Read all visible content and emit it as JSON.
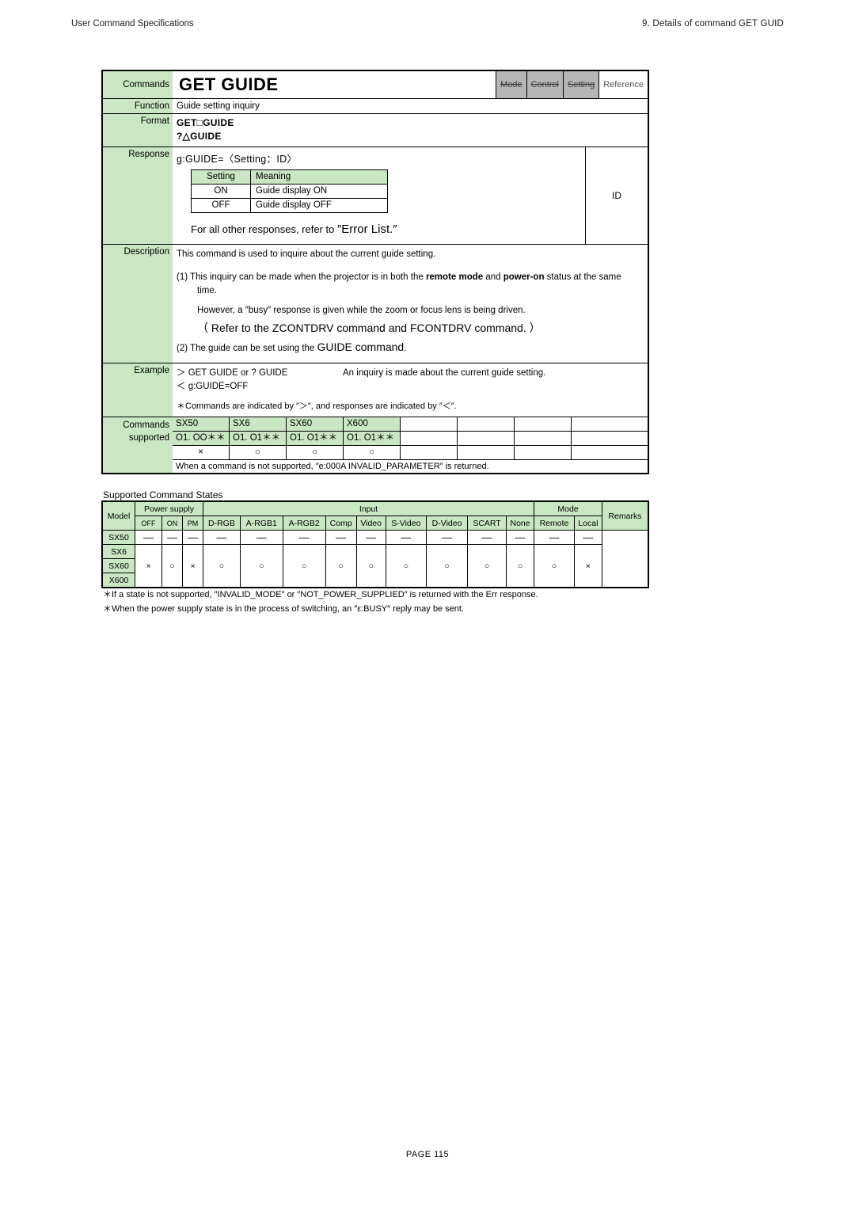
{
  "header": {
    "left": "User Command Specifications",
    "right": "9. Details of command  GET GUID"
  },
  "command_sheet": {
    "labels": {
      "commands": "Commands",
      "function": "Function",
      "format": "Format",
      "response": "Response",
      "description": "Description",
      "example": "Example",
      "commands_supported_1": "Commands",
      "commands_supported_2": "supported"
    },
    "title": "GET GUIDE",
    "tags": [
      {
        "text": "Mode",
        "state": "struck"
      },
      {
        "text": "Control",
        "state": "struck"
      },
      {
        "text": "Setting",
        "state": "struck"
      },
      {
        "text": "Reference",
        "state": "plain"
      }
    ],
    "function_text": "Guide setting inquiry",
    "format_lines": [
      "GET□GUIDE",
      "?△GUIDE"
    ],
    "response": {
      "syntax": "g:GUIDE=〈Setting：ID〉",
      "table": {
        "headers": [
          "Setting",
          "Meaning"
        ],
        "rows": [
          [
            "ON",
            "Guide display ON"
          ],
          [
            "OFF",
            "Guide display OFF"
          ]
        ]
      },
      "id_cell": "ID",
      "error_prefix": "For all other responses, refer to ",
      "error_ref": "″Error List.″"
    },
    "description": {
      "line1": "This command is used to inquire about the current guide setting.",
      "item1_pre": "(1) This inquiry can be made when the projector is in both the ",
      "item1_b1": "remote mode",
      "item1_mid": " and ",
      "item1_b2": "power-on",
      "item1_post": " status at the same time.",
      "item1_note": "However, a ″busy″ response is given while the zoom or focus lens is being driven.",
      "item1_ref": "（ Refer to the ZCONTDRV command and FCONTDRV command. ）",
      "item2_pre": "(2) The guide can be set using the ",
      "item2_cmd": "GUIDE command",
      "item2_post": "."
    },
    "example": {
      "send": "＞ GET GUIDE or ? GUIDE",
      "send_desc": "An inquiry is made about the current guide setting.",
      "recv": "＜ g:GUIDE=OFF",
      "note": "＊Commands are indicated by ″＞″, and responses are indicated by ″＜″."
    },
    "supported": {
      "models": [
        "SX50",
        "SX6",
        "SX60",
        "X600"
      ],
      "versions": [
        "O1. OO＊＊",
        "O1. O1＊＊",
        "O1. O1＊＊",
        "O1. O1＊＊"
      ],
      "marks": [
        "×",
        "○",
        "○",
        "○"
      ],
      "note": "When a command is not supported, ″e:000A INVALID_PARAMETER″ is returned."
    }
  },
  "states": {
    "caption": "Supported Command States",
    "group_headers": {
      "model": "Model",
      "power": "Power supply",
      "input": "Input",
      "mode": "Mode",
      "remarks": "Remarks"
    },
    "power_cols": [
      "OFF",
      "ON",
      "PM"
    ],
    "input_cols": [
      "D-RGB",
      "A-RGB1",
      "A-RGB2",
      "Comp",
      "Video",
      "S-Video",
      "D-Video",
      "SCART",
      "None"
    ],
    "mode_cols": [
      "Remote",
      "Local"
    ],
    "rows": [
      {
        "model": "SX50",
        "cells": [
          "—",
          "—",
          "—",
          "—",
          "—",
          "—",
          "—",
          "—",
          "—",
          "—",
          "—",
          "—",
          "—",
          "—"
        ],
        "remarks": ""
      },
      {
        "model_group": [
          "SX6",
          "SX60",
          "X600"
        ],
        "cells": [
          "×",
          "○",
          "×",
          "○",
          "○",
          "○",
          "○",
          "○",
          "○",
          "○",
          "○",
          "○",
          "○",
          "×"
        ],
        "remarks": ""
      }
    ],
    "notes": [
      "＊If a state is not supported, ″INVALID_MODE″ or ″NOT_POWER_SUPPLIED″ is returned with the Err response.",
      "＊When the power supply state is in the process of switching, an ″ε:BUSY″ reply may be sent."
    ]
  },
  "footer": {
    "page": "PAGE  115"
  }
}
